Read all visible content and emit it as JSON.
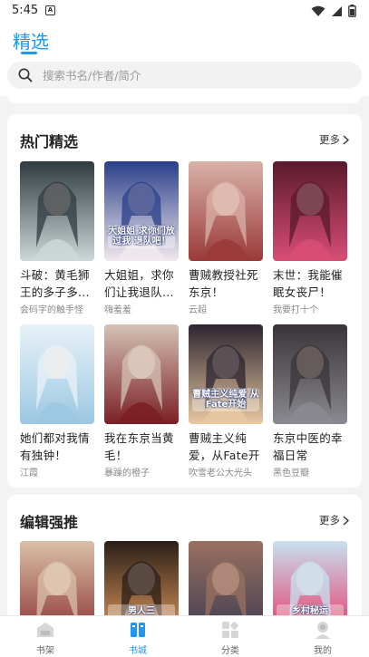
{
  "status_bar": {
    "time": "5:45",
    "notification_badge": "A",
    "icons": [
      "wifi-icon",
      "signal-icon",
      "battery-icon"
    ]
  },
  "header": {
    "title": "精选",
    "accent_color": "#2196f3"
  },
  "search": {
    "placeholder": "搜索书名/作者/简介"
  },
  "sections": [
    {
      "title": "热门精选",
      "more_label": "更多",
      "books": [
        {
          "title": "斗破：黄毛狮王的多子多...",
          "author": "会码字的触手怪",
          "cover_colors": [
            "#2f3b40",
            "#cdd8d8"
          ]
        },
        {
          "title": "大姐姐，求你们让我退队...",
          "author": "嗨羞羞",
          "cover_colors": [
            "#2a3f8a",
            "#f1e9ee"
          ],
          "cover_text": "大姐姐 求你们放过我 退队吧！"
        },
        {
          "title": "曹贼教授社死东京！",
          "author": "云超",
          "cover_colors": [
            "#d9b2a8",
            "#9a3a3a"
          ]
        },
        {
          "title": "末世：我能催眠女丧尸！",
          "author": "我要打十个",
          "cover_colors": [
            "#5a1a2e",
            "#d84d76"
          ]
        },
        {
          "title": "她们都对我情有独钟！",
          "author": "江霞",
          "cover_colors": [
            "#e8f2f8",
            "#9cc8e2"
          ]
        },
        {
          "title": "我在东京当黄毛！",
          "author": "暴躁的橙子",
          "cover_colors": [
            "#d4c2b4",
            "#7b1f24"
          ]
        },
        {
          "title": "曹贼主义纯爱，从Fate开始",
          "author": "吹雪老公大光头",
          "cover_colors": [
            "#2c2530",
            "#e8c8a0"
          ],
          "cover_text": "曹贼主义纯爱 从Fate开始"
        },
        {
          "title": "东京中医的幸福日常",
          "author": "黑色豆瓣",
          "cover_colors": [
            "#3a3438",
            "#8a8a90"
          ]
        }
      ]
    },
    {
      "title": "编辑强推",
      "more_label": "更多",
      "books": [
        {
          "title": "",
          "author": "",
          "cover_colors": [
            "#d9c0a8",
            "#8a3030"
          ]
        },
        {
          "title": "",
          "author": "",
          "cover_colors": [
            "#2a1e18",
            "#e8a060"
          ],
          "cover_text": "男人三"
        },
        {
          "title": "",
          "author": "",
          "cover_colors": [
            "#9a7060",
            "#3a3a50"
          ]
        },
        {
          "title": "",
          "author": "",
          "cover_colors": [
            "#c8e0f0",
            "#e83060"
          ],
          "cover_text": "乡村秘运"
        }
      ]
    }
  ],
  "bottom_nav": [
    {
      "label": "书架",
      "icon": "bookshelf-icon",
      "active": false
    },
    {
      "label": "书城",
      "icon": "bookstore-icon",
      "active": true
    },
    {
      "label": "分类",
      "icon": "category-icon",
      "active": false
    },
    {
      "label": "我的",
      "icon": "profile-icon",
      "active": false
    }
  ]
}
